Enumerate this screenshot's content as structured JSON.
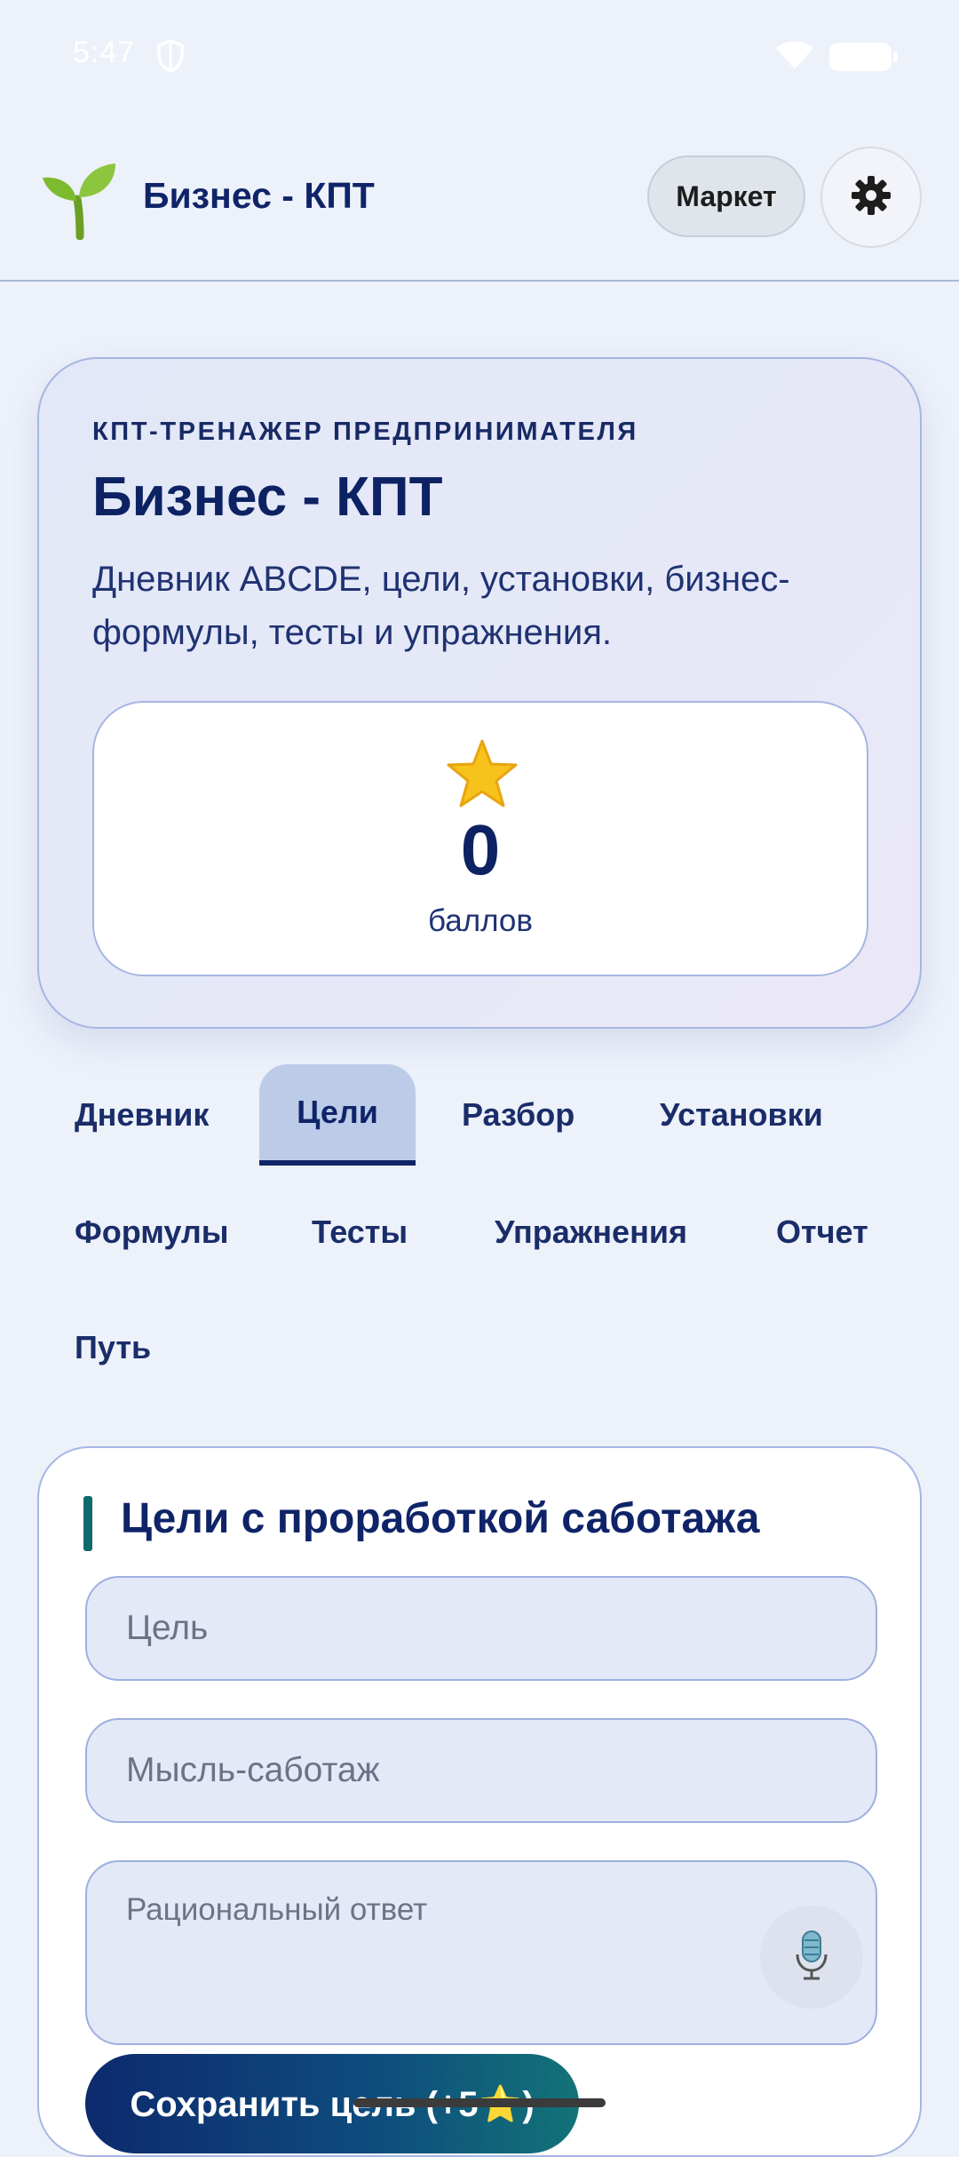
{
  "status_bar": {
    "time": "5:47"
  },
  "header": {
    "title": "Бизнес - КПТ",
    "market_label": "Маркет"
  },
  "hero": {
    "kicker": "КПТ-ТРЕНАЖЕР ПРЕДПРИНИМАТЕЛЯ",
    "title": "Бизнес - КПТ",
    "description": "Дневник ABCDE, цели, установки, бизнес-формулы, тесты и упражнения.",
    "score": {
      "value": "0",
      "label": "баллов"
    }
  },
  "tabs": [
    {
      "label": "Дневник",
      "active": false
    },
    {
      "label": "Цели",
      "active": true
    },
    {
      "label": "Разбор",
      "active": false
    },
    {
      "label": "Установки",
      "active": false
    },
    {
      "label": "Формулы",
      "active": false
    },
    {
      "label": "Тесты",
      "active": false
    },
    {
      "label": "Упражнения",
      "active": false
    },
    {
      "label": "Отчет",
      "active": false
    },
    {
      "label": "Путь",
      "active": false
    }
  ],
  "goals_form": {
    "title": "Цели с проработкой саботажа",
    "goal_placeholder": "Цель",
    "sabotage_placeholder": "Мысль-саботаж",
    "rational_placeholder": "Рациональный ответ",
    "save_label": "Сохранить цель (+5⭐)"
  },
  "colors": {
    "primary": "#0f2468",
    "accent_teal": "#0f6a6b",
    "background": "#edf1fa",
    "active_tab_bg": "#bccbe8"
  },
  "icons": {
    "logo": "seedling-icon",
    "settings": "gear-icon",
    "score": "star-icon",
    "voice": "microphone-icon"
  }
}
